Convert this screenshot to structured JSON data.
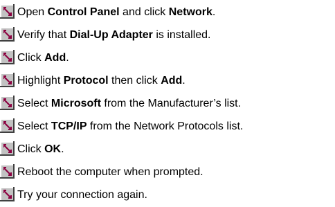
{
  "icon": {
    "name": "step-arrow-icon",
    "colors": {
      "face": "#c2c2c2",
      "highlight": "#ffffff",
      "shadow": "#404040",
      "arrow": "#8b0040"
    }
  },
  "steps": [
    {
      "pre": "Open ",
      "b1": "Control Panel",
      "mid": " and click ",
      "b2": "Network",
      "post": "."
    },
    {
      "pre": "Verify that ",
      "b1": "Dial-Up Adapter",
      "mid": " is installed.",
      "b2": "",
      "post": ""
    },
    {
      "pre": "Click ",
      "b1": "Add",
      "mid": ".",
      "b2": "",
      "post": ""
    },
    {
      "pre": "Highlight ",
      "b1": "Protocol",
      "mid": " then click ",
      "b2": "Add",
      "post": "."
    },
    {
      "pre": "Select ",
      "b1": "Microsoft",
      "mid": " from the Manufacturer’s list.",
      "b2": "",
      "post": ""
    },
    {
      "pre": "Select ",
      "b1": "TCP/IP",
      "mid": " from the Network Protocols list.",
      "b2": "",
      "post": ""
    },
    {
      "pre": "Click ",
      "b1": "OK",
      "mid": ".",
      "b2": "",
      "post": ""
    },
    {
      "pre": "Reboot the computer when prompted.",
      "b1": "",
      "mid": "",
      "b2": "",
      "post": ""
    },
    {
      "pre": "Try your connection again.",
      "b1": "",
      "mid": "",
      "b2": "",
      "post": ""
    }
  ]
}
